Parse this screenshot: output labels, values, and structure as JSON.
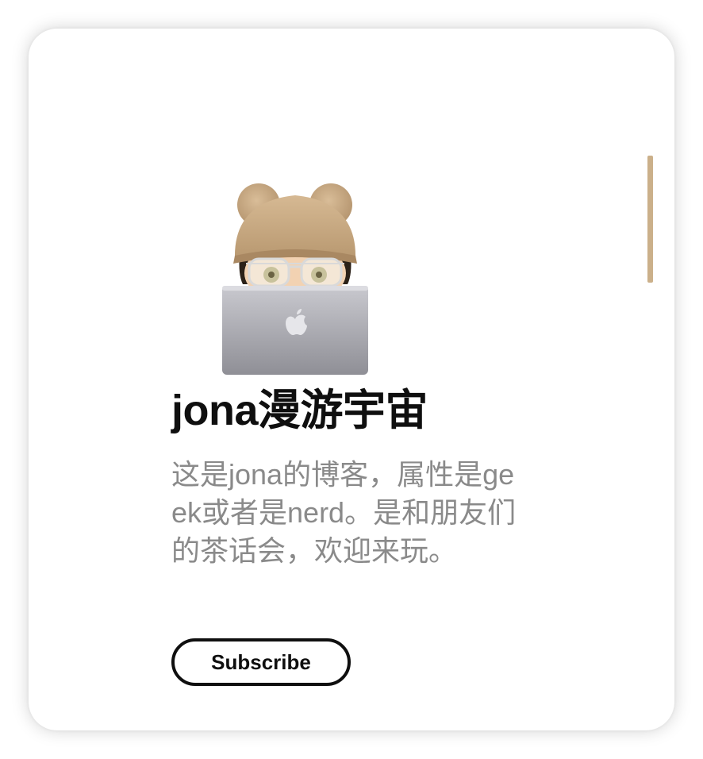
{
  "profile": {
    "title": "jona漫游宇宙",
    "description": "这是jona的博客，属性是geek或者是nerd。是和朋友们的茶话会，欢迎来玩。",
    "subscribe_label": "Subscribe",
    "avatar_icon": "memoji-laptop-avatar"
  },
  "colors": {
    "accent": "#cbb08a",
    "title": "#0f0f0f",
    "description": "#8a8a8a",
    "button_border": "#0f0f0f"
  }
}
